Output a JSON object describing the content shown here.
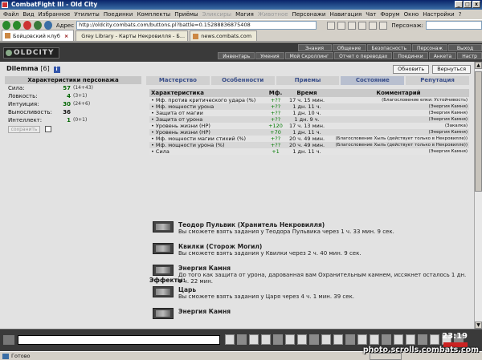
{
  "window": {
    "title": "CombatFight III - Old City"
  },
  "menu": [
    "Файл",
    "Вид",
    "Избранное",
    "Утилиты",
    "Поединки",
    "Комплекты",
    "Приёмы",
    "Эликсиры",
    "Магия",
    "Животное",
    "Персонажи",
    "Навигация",
    "Чат",
    "Форум",
    "Окно",
    "Настройки",
    "?"
  ],
  "menu_disabled": [
    "Эликсиры",
    "Животное"
  ],
  "address": {
    "label": "Адрес",
    "url": "http://oldcity.combats.com/buttons.pl?battle=0.15288836875408",
    "persona_label": "Персонаж:"
  },
  "tabs": [
    {
      "label": "Бойцовский клуб",
      "active": true
    },
    {
      "label": "Grey Library - Карты Некровилля - Б...",
      "active": false
    },
    {
      "label": "news.combats.com",
      "active": false
    }
  ],
  "game": {
    "logo": "OLDCITY",
    "nav_top": [
      "Знания",
      "Общение",
      "Безопасность",
      "Персонаж",
      "Выход"
    ],
    "nav_bottom": [
      "Инвентарь",
      "Умения",
      "Мой Скроллинг",
      "Отчет о переводах",
      "Поединки",
      "Анкета",
      "Настр"
    ]
  },
  "character": {
    "name": "Dilemma",
    "level": "[6]",
    "info_icon": "i"
  },
  "buttons": {
    "refresh": "Обновить",
    "back": "Вернуться",
    "save": "сохранить"
  },
  "stats": {
    "title": "Характеристики персонажа",
    "rows": [
      {
        "label": "Сила:",
        "value": "57",
        "bonus": "(14+43)",
        "green": true
      },
      {
        "label": "Ловкость:",
        "value": "4",
        "bonus": "(3+1)",
        "green": true
      },
      {
        "label": "Интуиция:",
        "value": "30",
        "bonus": "(24+6)",
        "green": true
      },
      {
        "label": "Выносливость:",
        "value": "36",
        "bonus": "",
        "green": false
      },
      {
        "label": "Интеллект:",
        "value": "1",
        "bonus": "(0+1)",
        "green": true
      }
    ]
  },
  "section_tabs": [
    {
      "label": "Мастерство",
      "active": false
    },
    {
      "label": "Особенности",
      "active": false
    },
    {
      "label": "Приемы",
      "active": false
    },
    {
      "label": "Состояние",
      "active": true
    },
    {
      "label": "Репутация",
      "active": false
    }
  ],
  "buffs": {
    "headers": [
      "Характеристика",
      "Мф.",
      "Время",
      "Комментарий"
    ],
    "rows": [
      {
        "name": "• Мф. против критического удара (%)",
        "mf": "+??",
        "time": "17 ч. 15 мин.",
        "comment": "(Благословение елки: Устойчивость)"
      },
      {
        "name": "• Мф. мощности урона",
        "mf": "+??",
        "time": "1 дн. 11 ч.",
        "comment": "(Энергия Камня)"
      },
      {
        "name": "• Защита от магии",
        "mf": "+??",
        "time": "1 дн. 10 ч.",
        "comment": "(Энергия Камня)"
      },
      {
        "name": "• Защита от урона",
        "mf": "+??",
        "time": "1 дн. 9 ч.",
        "comment": "(Энергия Камня)"
      },
      {
        "name": "• Уровень жизни (HP)",
        "mf": "+120",
        "time": "17 ч. 13 мин.",
        "comment": "(Закалка)"
      },
      {
        "name": "• Уровень жизни (HP)",
        "mf": "+70",
        "time": "1 дн. 11 ч.",
        "comment": "(Энергия Камня)"
      },
      {
        "name": "• Мф. мощности магии стихий (%)",
        "mf": "+??",
        "time": "20 ч. 49 мин.",
        "comment": "(Благословение Хыль (действует только в Некровилле))"
      },
      {
        "name": "• Мф. мощности урона (%)",
        "mf": "+??",
        "time": "20 ч. 49 мин.",
        "comment": "(Благословение Хыль (действует только в Некровилле))"
      },
      {
        "name": "• Сила",
        "mf": "+1",
        "time": "1 дн. 11 ч.",
        "comment": "(Энергия Камня)"
      }
    ]
  },
  "effects": {
    "title": "Эффекты:",
    "items": [
      {
        "title": "Теодор Пульвик (Хранитель Некровилля)",
        "desc": "Вы сможете взять задания у Теодора Пульвика через 1 ч. 33 мин. 9 сек."
      },
      {
        "title": "Квилки (Сторож Могил)",
        "desc": "Вы сможете взять задания у Квилки через 2 ч. 40 мин. 9 сек."
      },
      {
        "title": "Энергия Камня",
        "desc": "До того как защита от урона, дарованная вам Охранительным камнем, иссякнет осталось 1 дн. 9 ч. 22 мин."
      },
      {
        "title": "Царь",
        "desc": "Вы сможете взять задания у Царя через 4 ч. 1 мин. 39 сек."
      },
      {
        "title": "Энергия Камня",
        "desc": ""
      }
    ]
  },
  "status": {
    "text": "Готово",
    "clock": "23:19",
    "watermark": "photo.scrolls.combats.com"
  }
}
